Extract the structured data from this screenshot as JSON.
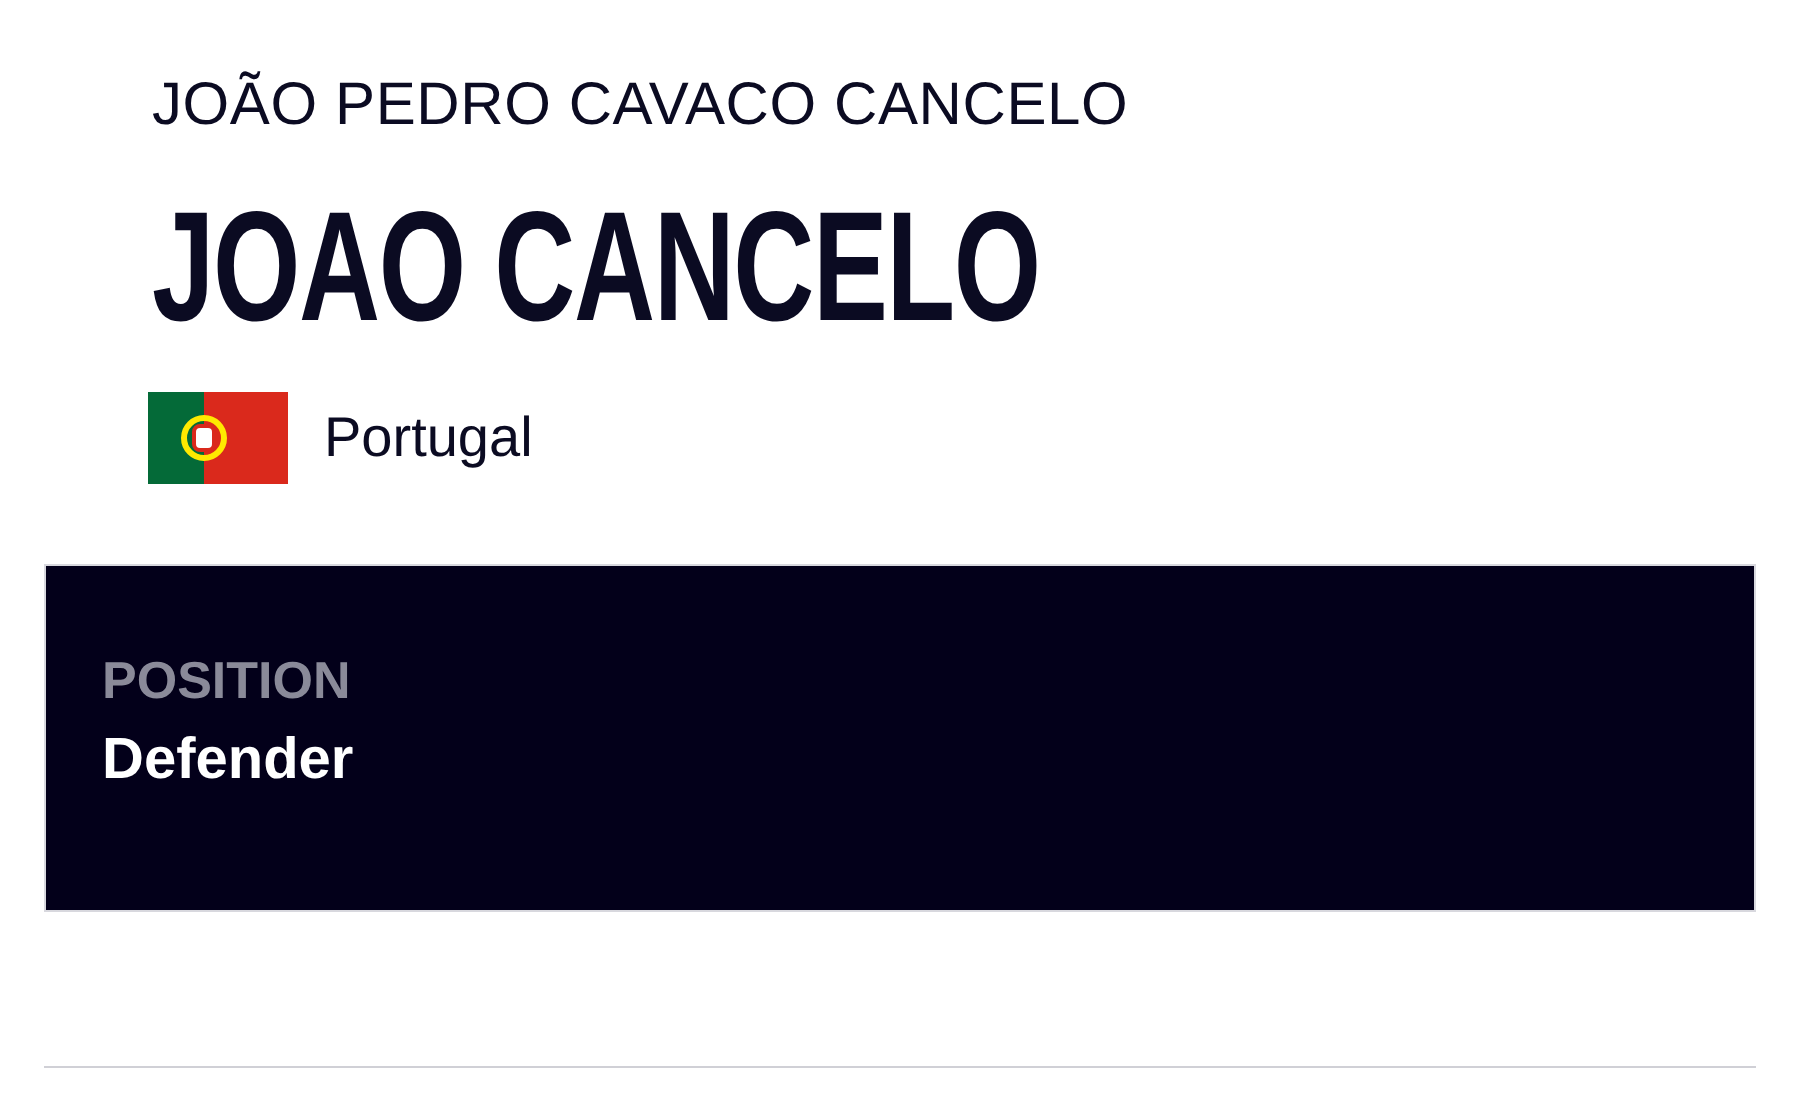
{
  "player": {
    "full_name": "JOÃO PEDRO CAVACO CANCELO",
    "display_name": "JOAO CANCELO",
    "country": "Portugal"
  },
  "details": [
    {
      "label": "POSITION",
      "value": "Defender"
    }
  ]
}
